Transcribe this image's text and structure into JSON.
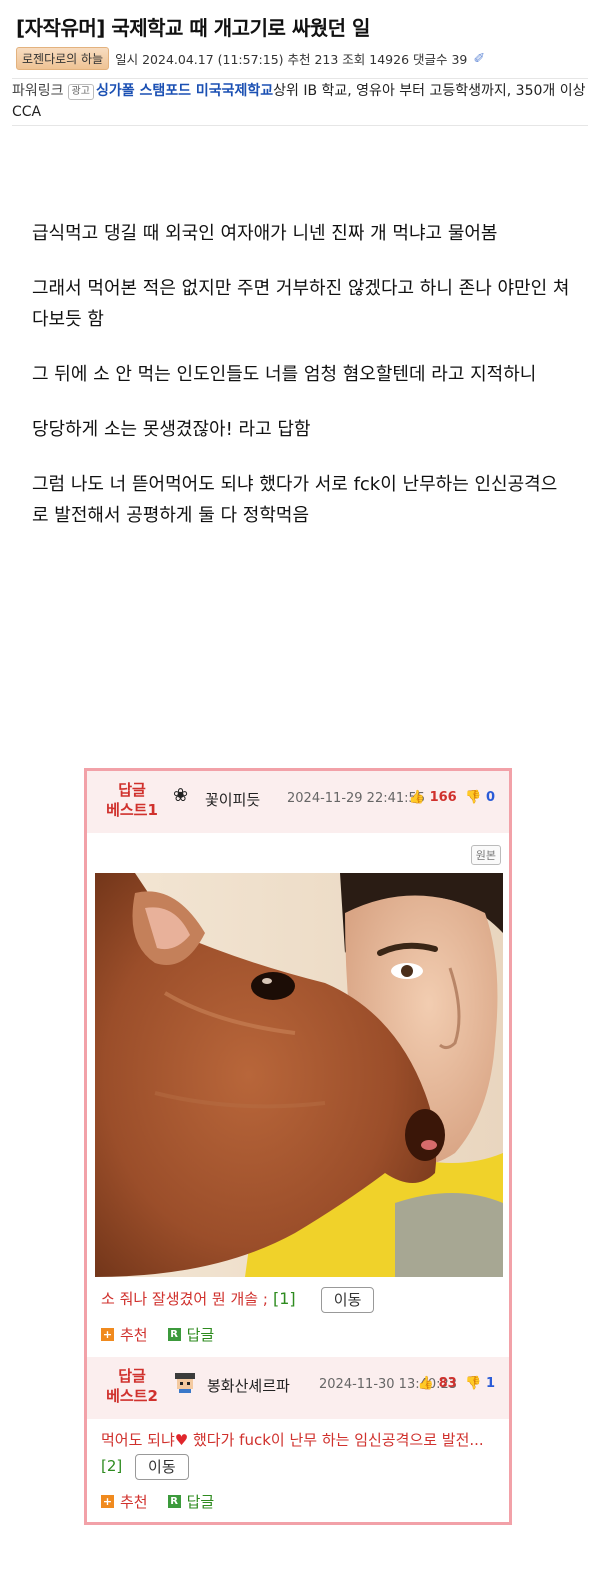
{
  "post": {
    "title": "[자작유머] 국제학교 때 개고기로 싸웠던 일",
    "author": "로젠다로의 하늘",
    "meta": "일시 2024.04.17 (11:57:15) 추천 213 조회 14926 댓글수 39"
  },
  "powerlink": {
    "label": "파워링크",
    "ad": "광고",
    "link": "싱가폴 스탬포드 미국국제학교",
    "text": "상위 IB 학교, 영유아 부터 고등학생까지, 350개 이상 CCA"
  },
  "body": [
    "급식먹고 댕길 때 외국인 여자애가 니넨 진짜 개 먹냐고 물어봄",
    "그래서 먹어본 적은 없지만 주면 거부하진 않겠다고 하니 존나 야만인 쳐다보듯 함",
    "그 뒤에 소 안 먹는 인도인들도 너를 엄청 혐오할텐데 라고 지적하니",
    "당당하게 소는 못생겼잖아! 라고 답함",
    "그럼 나도 너 뜯어먹어도 되냐 했다가 서로 fck이 난무하는 인신공격으로 발전해서 공평하게 둘 다 정학먹음"
  ],
  "best1": {
    "label_line1": "답글",
    "label_line2": "베스트1",
    "avatar_icon": "flower-avatar-icon",
    "author": "꽃이피듯",
    "date": "2024-11-29 22:41:55",
    "up": "166",
    "down": "0",
    "orig_btn": "원본",
    "text": "소 줘나 잘생겼어 뭔 개솔 ;",
    "reply_count": "[1]",
    "move_btn": "이동",
    "rec_label": "추천",
    "reply_label": "답글"
  },
  "best2": {
    "label_line1": "답글",
    "label_line2": "베스트2",
    "avatar_icon": "pixel-avatar-icon",
    "author": "봉화산셰르파",
    "date": "2024-11-30 13:40:23",
    "up": "83",
    "down": "1",
    "text_a": "먹어도 되냐",
    "text_b": " 했다가 fuck이 난무 하는 임신공격으로 발전...",
    "reply_count": "[2]",
    "move_btn": "이동",
    "rec_label": "추천",
    "reply_label": "답글"
  },
  "colors": {
    "accent_red": "#d0312d",
    "border_pink": "#f2a1a8",
    "head_bg": "#fbeeee",
    "link_blue": "#1b50b3"
  }
}
